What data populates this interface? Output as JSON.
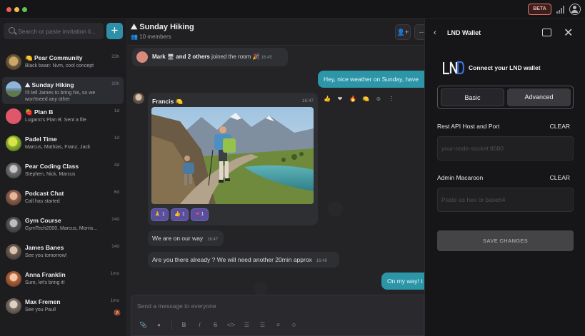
{
  "topbar": {
    "beta_label": "BETA"
  },
  "sidebar": {
    "search_placeholder": "Search or paste invitation li...",
    "add_label": "+",
    "rooms": [
      {
        "name": "🍋 Pear Community",
        "sub": "Black bean: Nvm, cool concept",
        "time": "23h"
      },
      {
        "name": "⛰ Sunday Hiking",
        "sub": "I'll tell James to bring his, so we won'tneed any other",
        "time": "10h"
      },
      {
        "name": "🍓 Plan B",
        "sub": "Lugano's Plan B: Sent a file",
        "time": "1d"
      },
      {
        "name": "Padel Time",
        "sub": "Marcus, Mathias, Franz, Jack",
        "time": "1d"
      },
      {
        "name": "Pear Coding Class",
        "sub": "Stephen, Nick, Marcus",
        "time": "4d"
      },
      {
        "name": "Podcast Chat",
        "sub": "Call has started",
        "time": "6d"
      },
      {
        "name": "Gym Course",
        "sub": "GymTech2000, Marcus, Morris...",
        "time": "14d"
      },
      {
        "name": "James Banes",
        "sub": "See you tomorrow!",
        "time": "14d"
      },
      {
        "name": "Anna Franklin",
        "sub": "Sure, let's bring it!",
        "time": "1mo"
      },
      {
        "name": "Max Fremen",
        "sub": "See you Paul!",
        "time": "1mo"
      }
    ]
  },
  "chat": {
    "title": "⛰ Sunday Hiking",
    "members": "10 members",
    "join_name": "Mark",
    "join_text": "and 2 others",
    "join_suffix": "joined the room 🎉",
    "join_time": "16:45",
    "out_msg_1": "Hey, nice weather on Sunday, have",
    "francis_name": "Francis 🍋",
    "francis_time": "16:47",
    "reactions": [
      {
        "emoji": "🙏",
        "count": "1"
      },
      {
        "emoji": "👍",
        "count": "1"
      },
      {
        "emoji": "❤",
        "count": "1"
      }
    ],
    "msg_2": "We are on our way",
    "msg_2_time": "16:47",
    "msg_3": "Are you there already ? We will need another 20min approx",
    "msg_3_time": "16:48",
    "out_msg_2": "On my way! t",
    "composer_placeholder": "Send a message to everyone"
  },
  "panel": {
    "title": "LND Wallet",
    "connect": "Connect your LND wallet",
    "tab_basic": "Basic",
    "tab_advanced": "Advanced",
    "host_label": "Rest API Host and Port",
    "clear_label": "CLEAR",
    "host_placeholder": "your-node-socket:8080",
    "macaroon_label": "Admin Macaroon",
    "macaroon_placeholder": "Paste as hex or base64",
    "save_label": "SAVE CHANGES"
  }
}
